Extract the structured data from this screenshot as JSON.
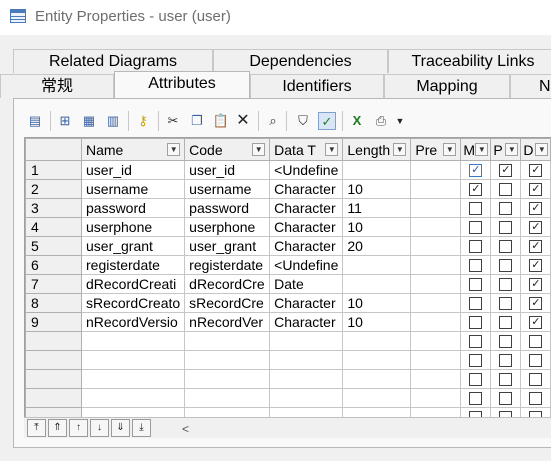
{
  "window": {
    "title": "Entity Properties - user (user)"
  },
  "tabs": {
    "row1": [
      "Related Diagrams",
      "Dependencies",
      "Traceability Links"
    ],
    "row2": [
      "常规",
      "Attributes",
      "Identifiers",
      "Mapping",
      "N"
    ],
    "active": "Attributes"
  },
  "toolbar": {
    "icons": [
      "properties-icon",
      "insert-row-icon",
      "add-row-icon",
      "add-attributes-icon",
      "key-icon",
      "cut-icon",
      "copy-icon",
      "paste-icon",
      "delete-icon",
      "find-icon",
      "filter-icon",
      "customize-columns-icon",
      "excel-export-icon",
      "print-icon",
      "dropdown-arrow-icon"
    ],
    "active": "customize-columns-icon"
  },
  "grid": {
    "columns": [
      "Name",
      "Code",
      "Data T",
      "Length",
      "Pre",
      "M",
      "P",
      "D"
    ],
    "rows": [
      {
        "n": "1",
        "name": "user_id",
        "code": "user_id",
        "type": "<Undefine",
        "length": "",
        "pre": "",
        "m": true,
        "p": true,
        "d": true
      },
      {
        "n": "2",
        "name": "username",
        "code": "username",
        "type": "Character",
        "length": "10",
        "pre": "",
        "m": true,
        "p": false,
        "d": true
      },
      {
        "n": "3",
        "name": "password",
        "code": "password",
        "type": "Character",
        "length": "11",
        "pre": "",
        "m": false,
        "p": false,
        "d": true
      },
      {
        "n": "4",
        "name": "userphone",
        "code": "userphone",
        "type": "Character",
        "length": "10",
        "pre": "",
        "m": false,
        "p": false,
        "d": true
      },
      {
        "n": "5",
        "name": "user_grant",
        "code": "user_grant",
        "type": "Character",
        "length": "20",
        "pre": "",
        "m": false,
        "p": false,
        "d": true
      },
      {
        "n": "6",
        "name": "registerdate",
        "code": "registerdate",
        "type": "<Undefine",
        "length": "",
        "pre": "",
        "m": false,
        "p": false,
        "d": true
      },
      {
        "n": "7",
        "name": "dRecordCreati",
        "code": "dRecordCre",
        "type": "Date",
        "length": "",
        "pre": "",
        "m": false,
        "p": false,
        "d": true
      },
      {
        "n": "8",
        "name": "sRecordCreato",
        "code": "sRecordCre",
        "type": "Character",
        "length": "10",
        "pre": "",
        "m": false,
        "p": false,
        "d": true
      },
      {
        "n": "9",
        "name": "nRecordVersio",
        "code": "nRecordVer",
        "type": "Character",
        "length": "10",
        "pre": "",
        "m": false,
        "p": false,
        "d": true
      }
    ],
    "empty_rows": 5
  },
  "navigation": {
    "buttons": [
      "first-page-icon",
      "page-up-icon",
      "row-up-icon",
      "row-down-icon",
      "page-down-icon",
      "last-page-icon"
    ],
    "glyphs": [
      "⤒",
      "⇑",
      "↑",
      "↓",
      "⇓",
      "⤓"
    ],
    "scroll_glyph": "<"
  }
}
